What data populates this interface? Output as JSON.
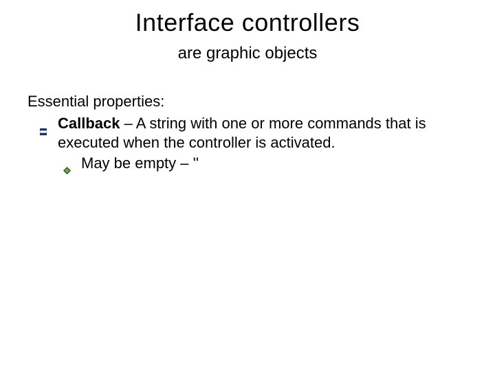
{
  "title": "Interface controllers",
  "subtitle": "are graphic objects",
  "lead": "Essential properties:",
  "item1_bold": "Callback",
  "item1_rest": " – A string with one or more commands that is executed when the controller is activated.",
  "item2": "May be empty – ''"
}
